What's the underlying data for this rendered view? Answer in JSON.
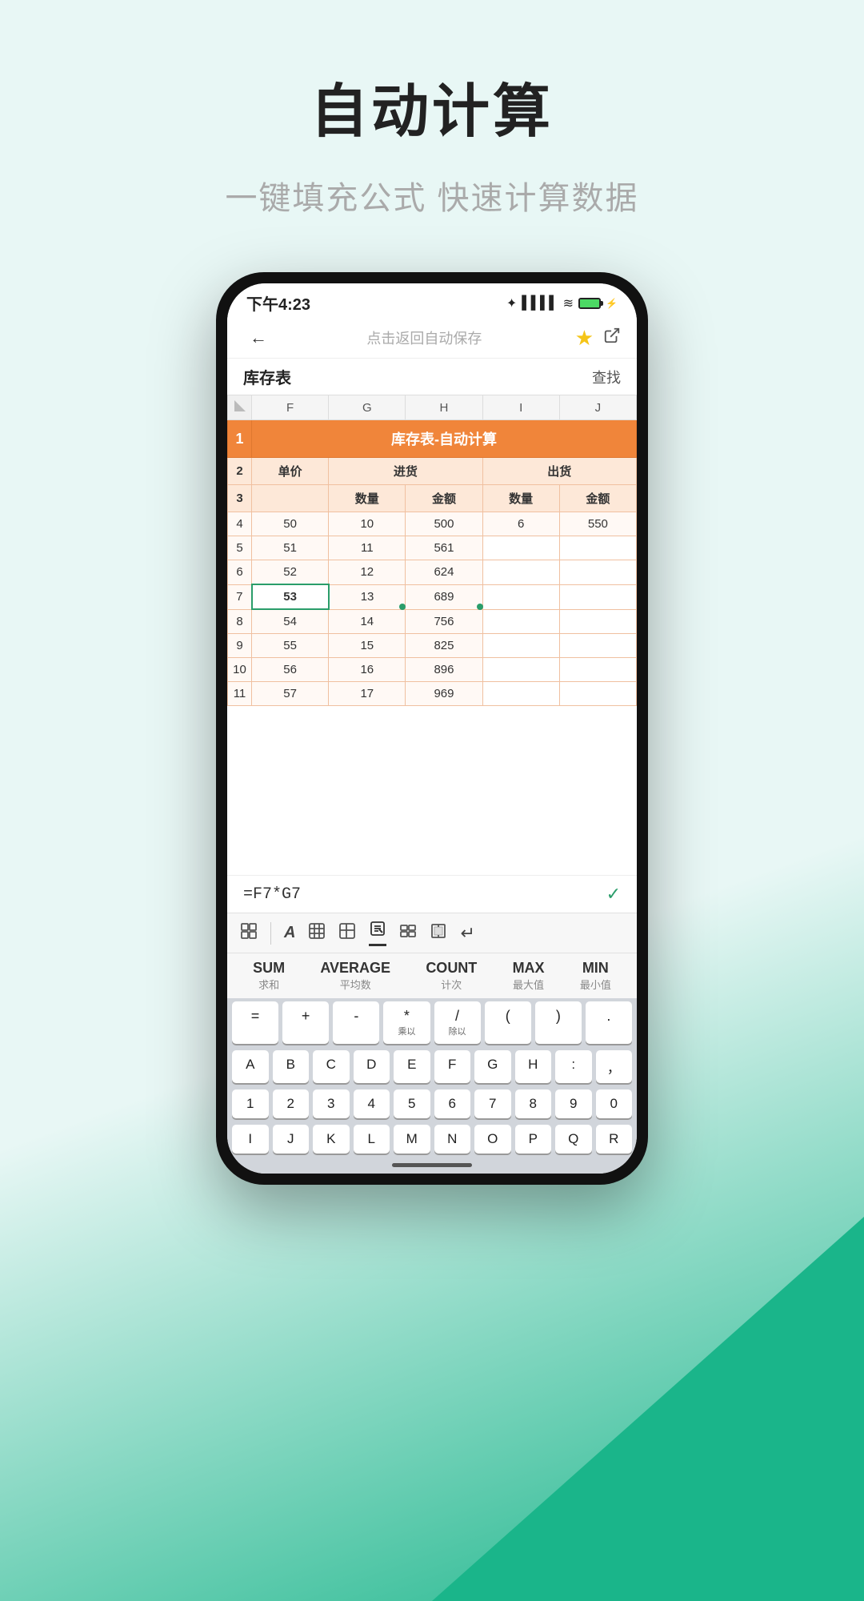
{
  "page": {
    "title": "自动计算",
    "subtitle": "一键填充公式 快速计算数据"
  },
  "status_bar": {
    "time": "下午4:23",
    "icons": "✦ ▲ ◉"
  },
  "nav": {
    "back": "←",
    "center_text": "点击返回自动保存",
    "export_icon": "⬡"
  },
  "sheet": {
    "name": "库存表",
    "find": "查找",
    "title_cell": "库存表-自动计算"
  },
  "columns": [
    "F",
    "G",
    "H",
    "I",
    "J"
  ],
  "formula": "=F7*G7",
  "functions": [
    {
      "name": "SUM",
      "sub": "求和"
    },
    {
      "name": "AVERAGE",
      "sub": "平均数"
    },
    {
      "name": "COUNT",
      "sub": "计次"
    },
    {
      "name": "MAX",
      "sub": "最大值"
    },
    {
      "name": "MIN",
      "sub": "最小值"
    }
  ],
  "sym_keys": [
    "=",
    "+",
    "-",
    "*\n乘以",
    "/\n除以",
    "(",
    ")",
    "."
  ],
  "letter_row1": [
    "A",
    "B",
    "C",
    "D",
    "E",
    "F",
    "G",
    "H",
    ":",
    "，"
  ],
  "letter_row2": [
    "1",
    "2",
    "3",
    "4",
    "5",
    "6",
    "7",
    "8",
    "9",
    "0"
  ],
  "letter_row3": [
    "I",
    "J",
    "K",
    "L",
    "M",
    "N",
    "O",
    "P",
    "Q",
    "R"
  ],
  "table_rows": [
    {
      "num": "2",
      "f": "单价",
      "g": "进货",
      "h": "",
      "i": "出货",
      "j": "",
      "type": "header2"
    },
    {
      "num": "3",
      "f": "",
      "g": "数量",
      "h": "金额",
      "i": "数量",
      "j": "金额",
      "type": "header3"
    },
    {
      "num": "4",
      "f": "50",
      "g": "10",
      "h": "500",
      "i": "6",
      "j": "550",
      "type": "data"
    },
    {
      "num": "5",
      "f": "51",
      "g": "11",
      "h": "561",
      "i": "",
      "j": "",
      "type": "data"
    },
    {
      "num": "6",
      "f": "52",
      "g": "12",
      "h": "624",
      "i": "",
      "j": "",
      "type": "data"
    },
    {
      "num": "7",
      "f": "53",
      "g": "13",
      "h": "689",
      "i": "",
      "j": "",
      "type": "data",
      "selected_f": true
    },
    {
      "num": "8",
      "f": "54",
      "g": "14",
      "h": "756",
      "i": "",
      "j": "",
      "type": "data"
    },
    {
      "num": "9",
      "f": "55",
      "g": "15",
      "h": "825",
      "i": "",
      "j": "",
      "type": "data"
    },
    {
      "num": "10",
      "f": "56",
      "g": "16",
      "h": "896",
      "i": "",
      "j": "",
      "type": "data"
    },
    {
      "num": "11",
      "f": "57",
      "g": "17",
      "h": "969",
      "i": "",
      "j": "",
      "type": "data"
    }
  ]
}
